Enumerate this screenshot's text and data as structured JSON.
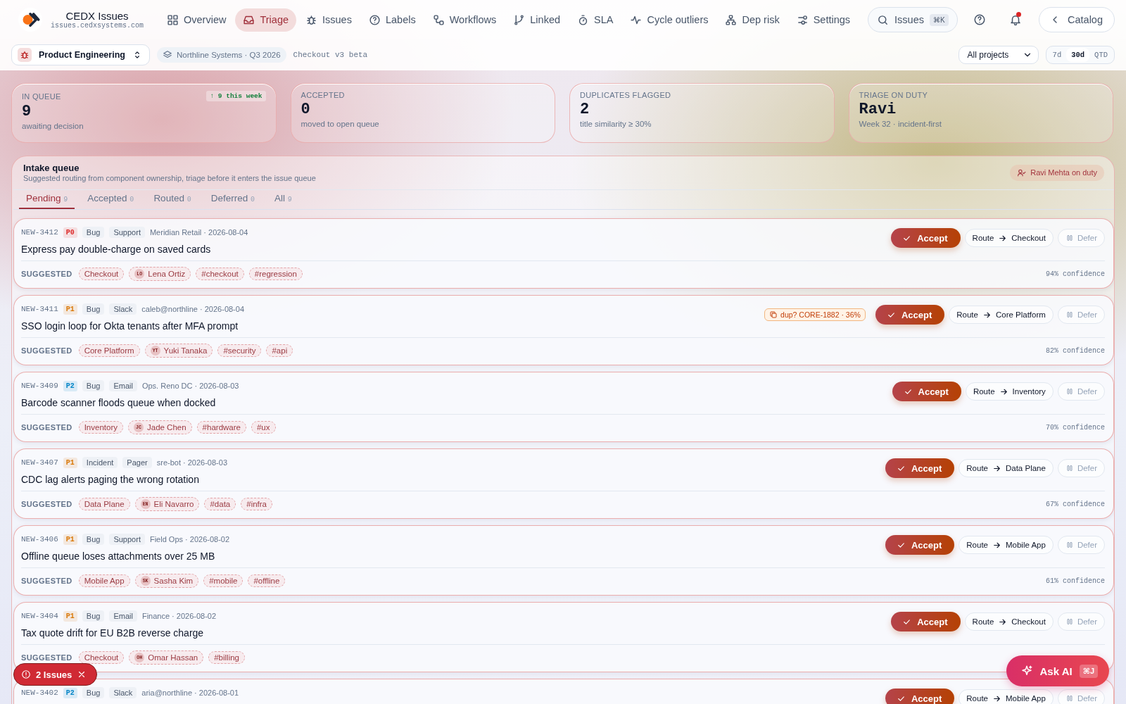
{
  "brand": {
    "name": "CEDX Issues",
    "domain": "issues.cedxsystems.com"
  },
  "nav": [
    {
      "label": "Overview",
      "selected": false
    },
    {
      "label": "Triage",
      "selected": true
    },
    {
      "label": "Issues",
      "selected": false
    },
    {
      "label": "Labels",
      "selected": false
    },
    {
      "label": "Workflows",
      "selected": false
    },
    {
      "label": "Linked",
      "selected": false
    },
    {
      "label": "SLA",
      "selected": false
    },
    {
      "label": "Cycle outliers",
      "selected": false
    },
    {
      "label": "Dep risk",
      "selected": false
    },
    {
      "label": "Settings",
      "selected": false
    }
  ],
  "search": {
    "label": "Issues",
    "shortcut": "⌘K"
  },
  "notifications": {
    "unread": true
  },
  "back_link": "Catalog",
  "subbar": {
    "workspace": "Product Engineering",
    "org": "Northline Systems · Q3 2026",
    "release": "Checkout v3 beta",
    "project_filter": "All projects",
    "ranges": [
      {
        "label": "7d",
        "selected": false
      },
      {
        "label": "30d",
        "selected": true
      },
      {
        "label": "QTD",
        "selected": false
      }
    ]
  },
  "kpis": [
    {
      "label": "IN QUEUE",
      "value": "9",
      "note": "awaiting decision",
      "trend": "↑ 9 this week"
    },
    {
      "label": "ACCEPTED",
      "value": "0",
      "note": "moved to open queue"
    },
    {
      "label": "DUPLICATES FLAGGED",
      "value": "2",
      "note": "title similarity ≥ 30%"
    },
    {
      "label": "TRIAGE ON DUTY",
      "value": "Ravi",
      "note": "Week 32 · incident-first"
    }
  ],
  "queue": {
    "title": "Intake queue",
    "subtitle": "Suggested routing from component ownership, triage before it enters the issue queue",
    "duty": "Ravi Mehta on duty",
    "tabs": [
      {
        "label": "Pending",
        "count": "9",
        "selected": true
      },
      {
        "label": "Accepted",
        "count": "0",
        "selected": false
      },
      {
        "label": "Routed",
        "count": "0",
        "selected": false
      },
      {
        "label": "Deferred",
        "count": "0",
        "selected": false
      },
      {
        "label": "All",
        "count": "9",
        "selected": false
      }
    ],
    "items": [
      {
        "id": "NEW-3412",
        "priority": {
          "label": "P0",
          "color": "#dc2626"
        },
        "type": "Bug",
        "source": "Support",
        "meta": "Meridian Retail · 2026-08-04",
        "title": "Express pay double-charge on saved cards",
        "accept": "Accept",
        "route": "Route",
        "route_to": "Checkout",
        "defer": "Defer",
        "suggested_label": "SUGGESTED",
        "suggestions": [
          {
            "kind": "team",
            "label": "Checkout"
          },
          {
            "kind": "person",
            "initials": "LO",
            "label": "Lena Ortiz"
          },
          {
            "kind": "tag",
            "label": "#checkout"
          },
          {
            "kind": "tag",
            "label": "#regression"
          }
        ],
        "confidence": "94% confidence"
      },
      {
        "id": "NEW-3411",
        "priority": {
          "label": "P1",
          "color": "#d97706"
        },
        "type": "Bug",
        "source": "Slack",
        "meta": "caleb@northline · 2026-08-04",
        "duplicate": "dup? CORE-1882 · 36%",
        "title": "SSO login loop for Okta tenants after MFA prompt",
        "accept": "Accept",
        "route": "Route",
        "route_to": "Core Platform",
        "defer": "Defer",
        "suggested_label": "SUGGESTED",
        "suggestions": [
          {
            "kind": "team",
            "label": "Core Platform"
          },
          {
            "kind": "person",
            "initials": "YT",
            "label": "Yuki Tanaka"
          },
          {
            "kind": "tag",
            "label": "#security"
          },
          {
            "kind": "tag",
            "label": "#api"
          }
        ],
        "confidence": "82% confidence"
      },
      {
        "id": "NEW-3409",
        "priority": {
          "label": "P2",
          "color": "#0284c7"
        },
        "type": "Bug",
        "source": "Email",
        "meta": "Ops. Reno DC · 2026-08-03",
        "title": "Barcode scanner floods queue when docked",
        "accept": "Accept",
        "route": "Route",
        "route_to": "Inventory",
        "defer": "Defer",
        "suggested_label": "SUGGESTED",
        "suggestions": [
          {
            "kind": "team",
            "label": "Inventory"
          },
          {
            "kind": "person",
            "initials": "JC",
            "label": "Jade Chen"
          },
          {
            "kind": "tag",
            "label": "#hardware"
          },
          {
            "kind": "tag",
            "label": "#ux"
          }
        ],
        "confidence": "70% confidence"
      },
      {
        "id": "NEW-3407",
        "priority": {
          "label": "P1",
          "color": "#d97706"
        },
        "type": "Incident",
        "source": "Pager",
        "meta": "sre-bot · 2026-08-03",
        "title": "CDC lag alerts paging the wrong rotation",
        "accept": "Accept",
        "route": "Route",
        "route_to": "Data Plane",
        "defer": "Defer",
        "suggested_label": "SUGGESTED",
        "suggestions": [
          {
            "kind": "team",
            "label": "Data Plane"
          },
          {
            "kind": "person",
            "initials": "EN",
            "label": "Eli Navarro"
          },
          {
            "kind": "tag",
            "label": "#data"
          },
          {
            "kind": "tag",
            "label": "#infra"
          }
        ],
        "confidence": "67% confidence"
      },
      {
        "id": "NEW-3406",
        "priority": {
          "label": "P1",
          "color": "#d97706"
        },
        "type": "Bug",
        "source": "Support",
        "meta": "Field Ops · 2026-08-02",
        "title": "Offline queue loses attachments over 25 MB",
        "accept": "Accept",
        "route": "Route",
        "route_to": "Mobile App",
        "defer": "Defer",
        "suggested_label": "SUGGESTED",
        "suggestions": [
          {
            "kind": "team",
            "label": "Mobile App"
          },
          {
            "kind": "person",
            "initials": "SK",
            "label": "Sasha Kim"
          },
          {
            "kind": "tag",
            "label": "#mobile"
          },
          {
            "kind": "tag",
            "label": "#offline"
          }
        ],
        "confidence": "61% confidence"
      },
      {
        "id": "NEW-3404",
        "priority": {
          "label": "P1",
          "color": "#d97706"
        },
        "type": "Bug",
        "source": "Email",
        "meta": "Finance · 2026-08-02",
        "title": "Tax quote drift for EU B2B reverse charge",
        "accept": "Accept",
        "route": "Route",
        "route_to": "Checkout",
        "defer": "Defer",
        "suggested_label": "SUGGESTED",
        "suggestions": [
          {
            "kind": "team",
            "label": "Checkout"
          },
          {
            "kind": "person",
            "initials": "OH",
            "label": "Omar Hassan"
          },
          {
            "kind": "tag",
            "label": "#billing"
          }
        ]
      },
      {
        "id": "NEW-3402",
        "priority": {
          "label": "P2",
          "color": "#0284c7"
        },
        "type": "Bug",
        "source": "Slack",
        "meta": "aria@northline · 2026-08-01",
        "accept": "Accept",
        "route": "Route",
        "route_to": "Mobile App",
        "defer": "Defer"
      }
    ]
  },
  "issues_toast": "2 Issues",
  "ask_ai": {
    "label": "Ask AI",
    "shortcut": "⌘J"
  }
}
